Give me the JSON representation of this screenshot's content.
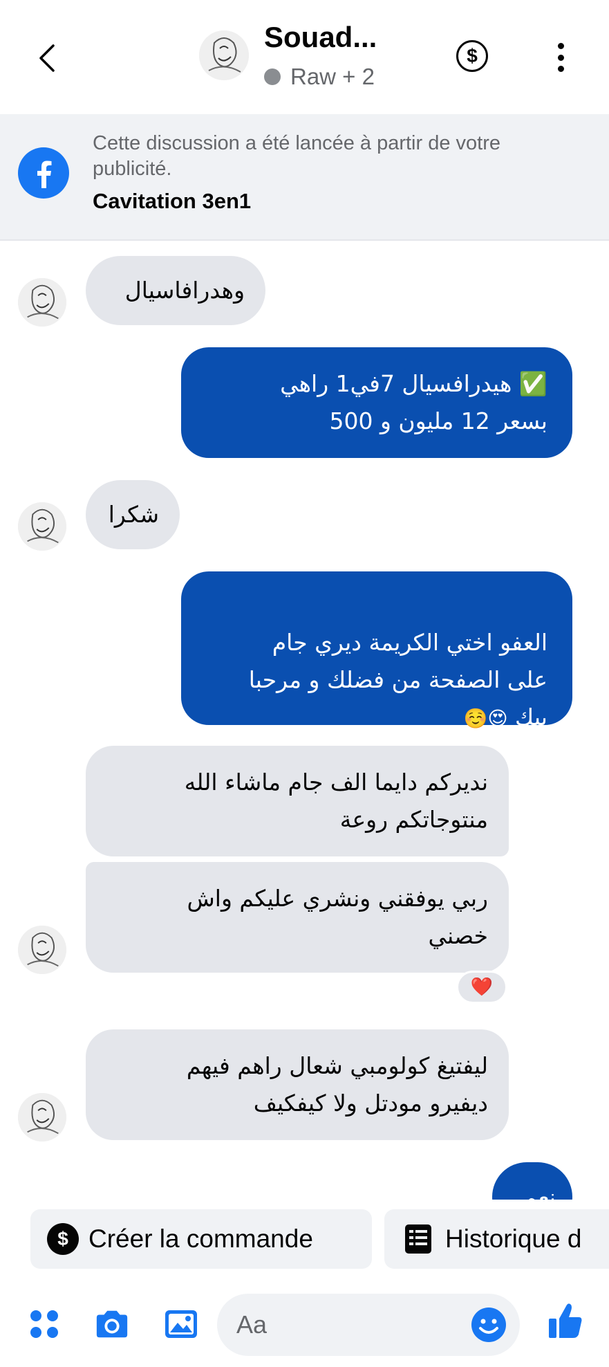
{
  "header": {
    "contact_name": "Souad...",
    "status": "Raw + 2"
  },
  "ad_banner": {
    "text": "Cette discussion a été lancée à partir de votre publicité.",
    "ad_name": "Cavitation 3en1"
  },
  "messages": [
    {
      "side": "incoming",
      "text": "وهدرافاسيال"
    },
    {
      "side": "outgoing",
      "text": "✅ هيدرافسيال 7في1 راهي\nبسعر 12 مليون و 500"
    },
    {
      "side": "incoming",
      "text": "شكرا"
    },
    {
      "side": "outgoing",
      "text": "العفو اختي الكريمة ديري جام\nعلى الصفحة من فضلك و مرحبا\nبيك",
      "emoji": "😍☺️"
    },
    {
      "side": "incoming",
      "text": "نديركم دايما الف جام ماشاء الله\nمنتوجاتكم روعة"
    },
    {
      "side": "incoming",
      "text": "ربي يوفقني ونشري عليكم واش\nخصني",
      "reaction": "❤️"
    },
    {
      "side": "incoming",
      "text": "ليفتيغ كولومبي شعال راهم فيهم\nديفيرو مودتل ولا كيفكيف"
    },
    {
      "side": "outgoing",
      "text": "نعم"
    }
  ],
  "quick_actions": {
    "create_order": "Créer la commande",
    "history": "Historique d"
  },
  "composer": {
    "placeholder": "Aa"
  },
  "colors": {
    "outgoing_bubble": "#0a4fb0",
    "incoming_bubble": "#e4e6eb",
    "accent": "#1877f2"
  }
}
